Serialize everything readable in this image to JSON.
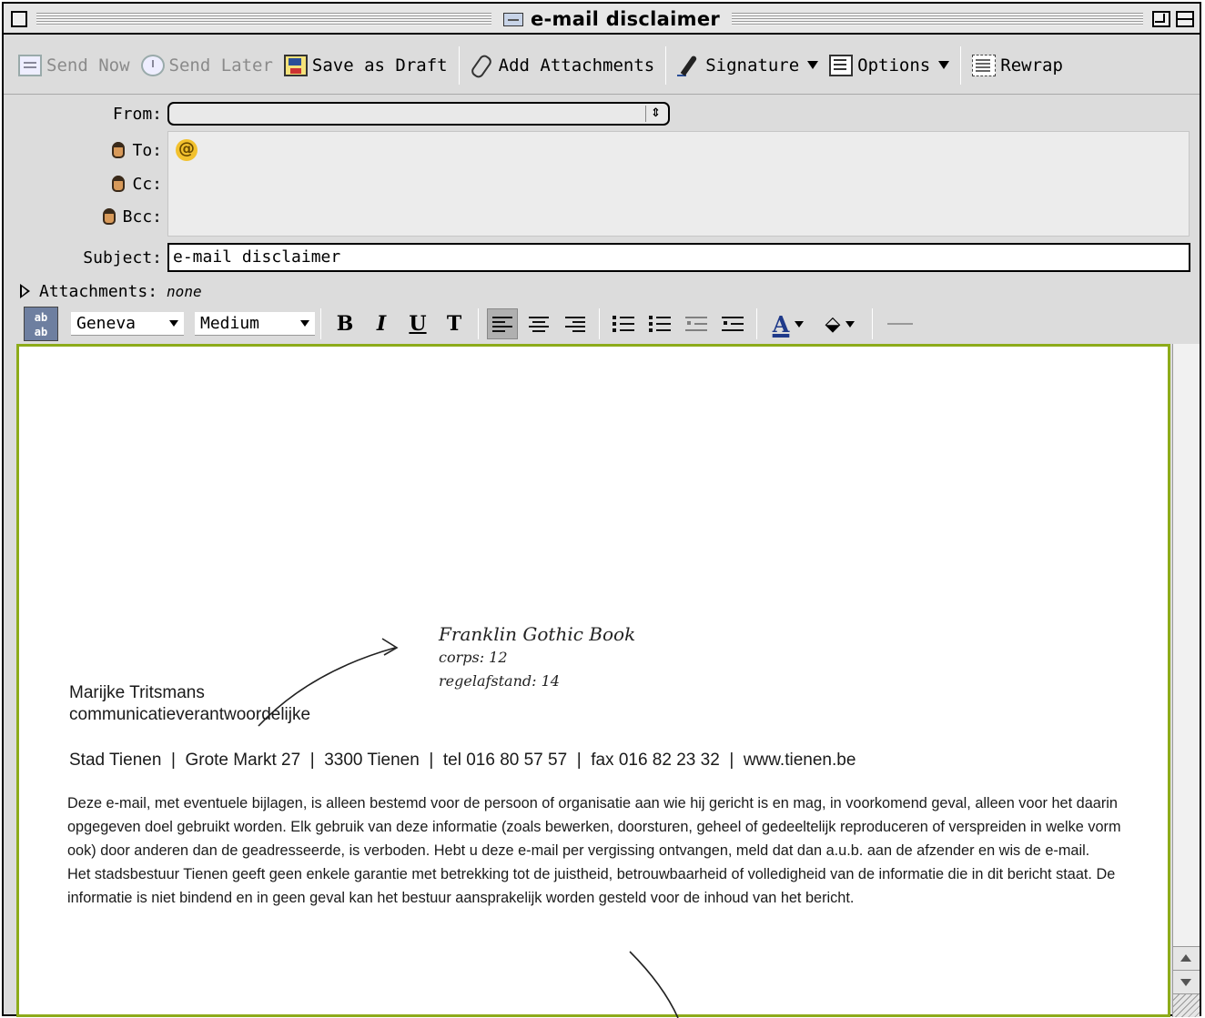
{
  "window": {
    "title": "e-mail disclaimer"
  },
  "toolbar": {
    "send_now": "Send Now",
    "send_later": "Send Later",
    "save_draft": "Save as Draft",
    "add_attachments": "Add Attachments",
    "signature": "Signature",
    "options": "Options",
    "rewrap": "Rewrap"
  },
  "header": {
    "from_label": "From:",
    "from_value": "",
    "to_label": "To:",
    "cc_label": "Cc:",
    "bcc_label": "Bcc:",
    "at_symbol": "@",
    "subject_label": "Subject:",
    "subject_value": "e-mail disclaimer",
    "attachments_label": "Attachments:",
    "attachments_value": "none"
  },
  "format": {
    "spell_label_top": "ab",
    "spell_label_bottom": "ab",
    "font": "Geneva",
    "size": "Medium",
    "bold": "B",
    "italic": "I",
    "underline": "U",
    "teletype": "T",
    "text_color": "A"
  },
  "message": {
    "name": "Marijke Tritsmans",
    "role": "communicatieverantwoordelijke",
    "contact": "Stad Tienen  |  Grote Markt 27  |  3300 Tienen  |  tel 016 80 57 57  |  fax 016 82 23 32  |  www.tienen.be",
    "disclaimer_1": "Deze e-mail, met eventuele bijlagen, is alleen bestemd voor de persoon of organisatie aan wie hij gericht is en mag, in voorkomend geval, alleen voor het daarin opgegeven doel gebruikt worden. Elk gebruik van deze informatie (zoals bewerken, doorsturen, geheel of gedeeltelijk reproduceren of verspreiden in welke vorm ook) door anderen dan de geadresseerde, is verboden. Hebt u deze e-mail per vergissing ontvangen, meld dat dan a.u.b. aan de afzender en wis de e-mail.",
    "disclaimer_2": "Het stadsbestuur Tienen geeft geen enkele garantie met betrekking tot de juistheid, betrouwbaarheid of volledigheid van de informatie die in dit bericht staat. De informatie is niet bindend en in geen geval kan het bestuur aansprakelijk worden gesteld voor de inhoud van het bericht."
  },
  "annotation": {
    "line1": "Franklin Gothic Book",
    "line2": "corps: 12",
    "line3": "regelafstand: 14"
  },
  "colors": {
    "body_border": "#8dab1a",
    "window_bg": "#dcdcdc"
  }
}
